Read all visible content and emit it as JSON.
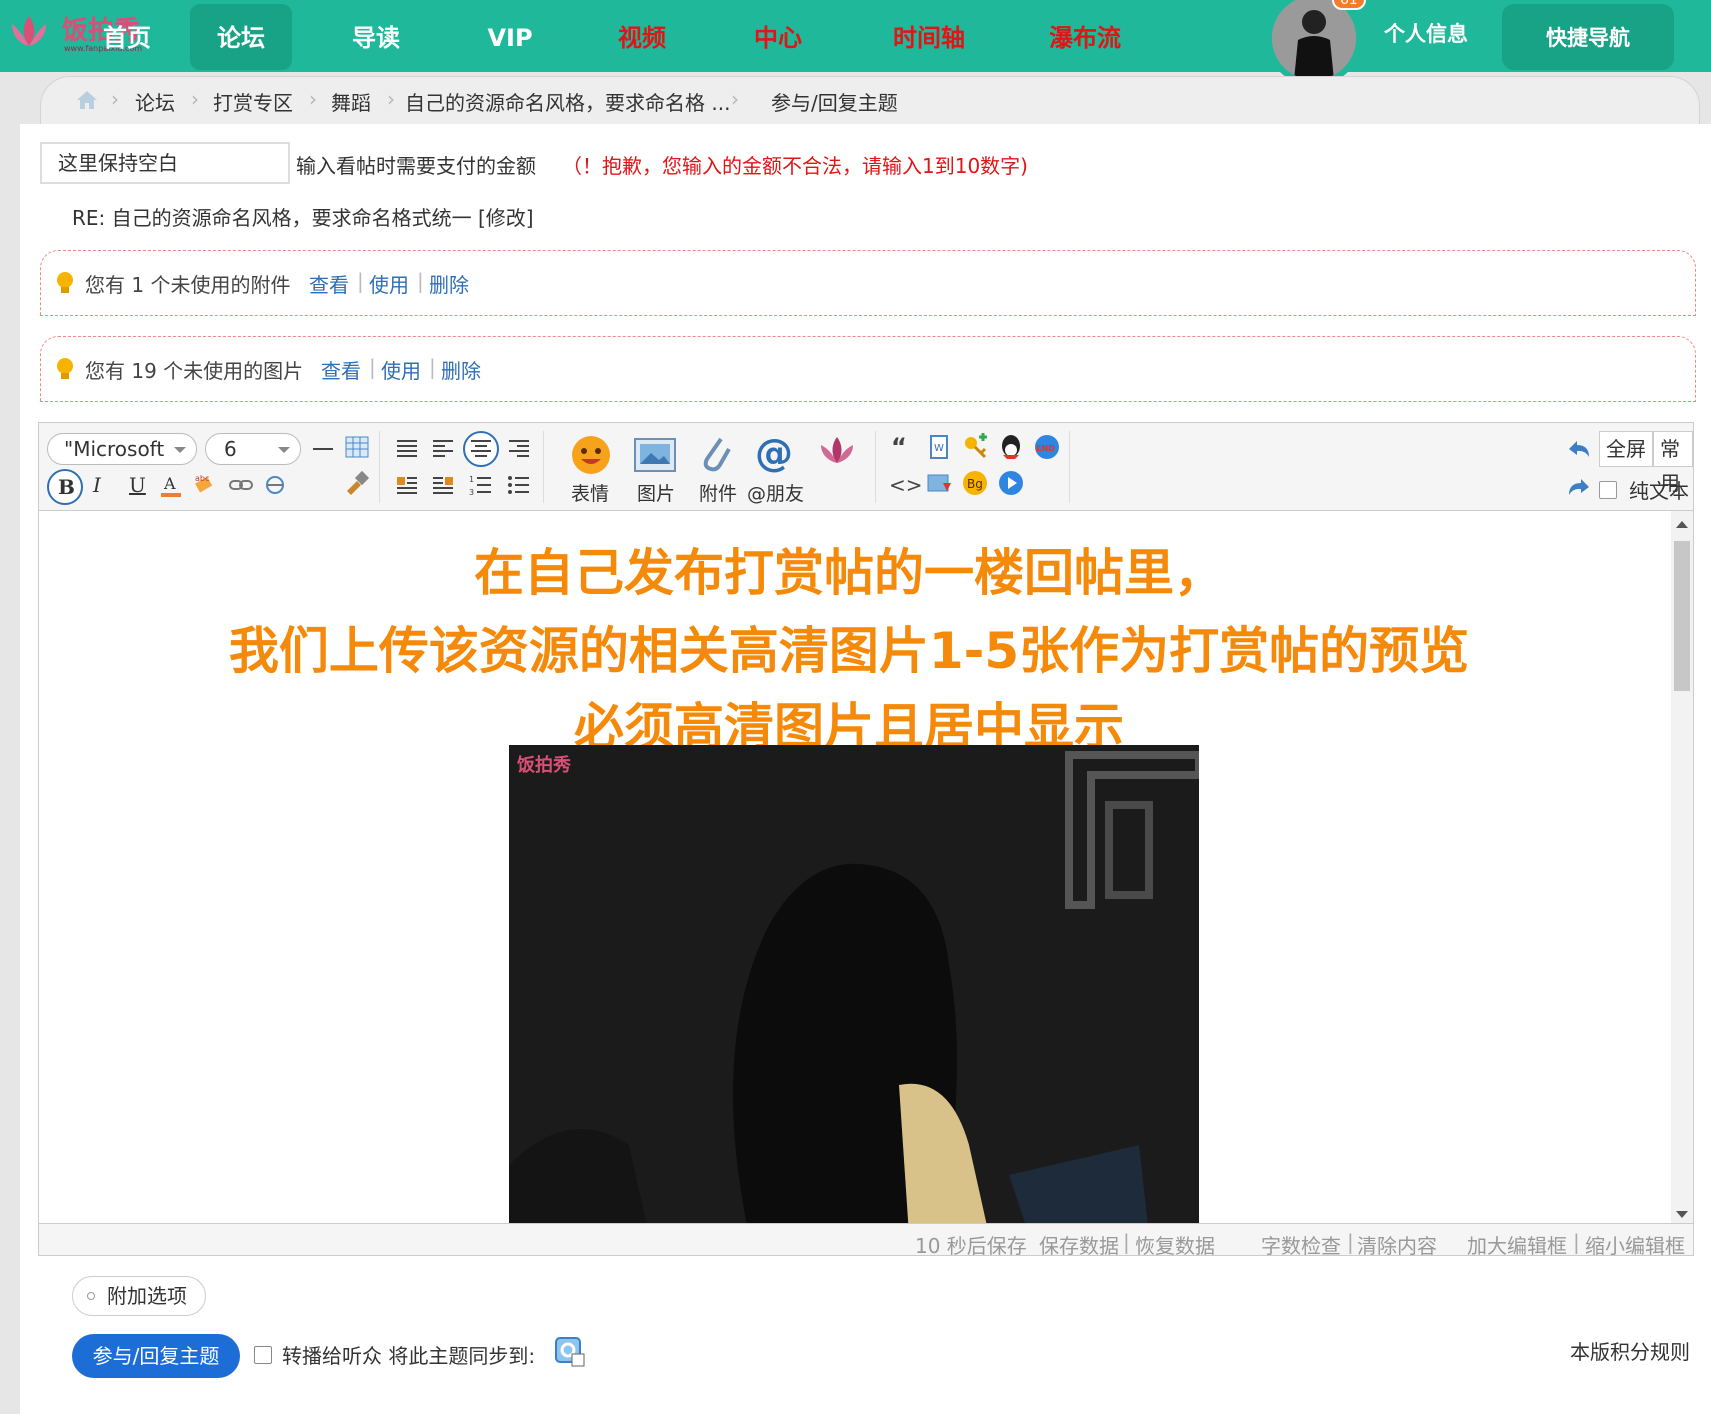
{
  "colors": {
    "brand_green": "#1fb89a",
    "nav_active": "#18a286",
    "nav_red": "#e01515",
    "headline_orange": "#f5890a",
    "link_blue": "#2f6fb5",
    "submit_blue": "#1c6ed6"
  },
  "logo": {
    "text": "饭拍秀",
    "sub": "www.fanpaixiu.com"
  },
  "nav": {
    "items": [
      {
        "label": "首页",
        "style": "normal"
      },
      {
        "label": "论坛",
        "style": "active"
      },
      {
        "label": "导读",
        "style": "normal"
      },
      {
        "label": "VIP",
        "style": "normal"
      },
      {
        "label": "视频",
        "style": "red"
      },
      {
        "label": "中心",
        "style": "red"
      },
      {
        "label": "时间轴",
        "style": "red"
      },
      {
        "label": "瀑布流",
        "style": "red"
      }
    ],
    "badge": "61",
    "profile": "个人信息",
    "quick_nav": "快捷导航"
  },
  "breadcrumb": [
    "论坛",
    "打赏专区",
    "舞蹈",
    "自己的资源命名风格，要求命名格 ...",
    "参与/回复主题"
  ],
  "form": {
    "amount_value": "这里保持空白",
    "amount_label": "输入看帖时需要支付的金额",
    "amount_error": "（！抱歉，您输入的金额不合法，请输入1到10数字)",
    "re_title": "RE: 自己的资源命名风格，要求命名格式统一 [修改]"
  },
  "notices": [
    {
      "text": "您有 1 个未使用的附件",
      "view": "查看",
      "use": "使用",
      "delete": "删除"
    },
    {
      "text": "您有 19 个未使用的图片",
      "view": "查看",
      "use": "使用",
      "delete": "删除"
    }
  ],
  "editor": {
    "font": "\"Microsoft",
    "size": "6",
    "big_buttons": [
      "表情",
      "图片",
      "附件",
      "@朋友"
    ],
    "fullscreen": "全屏",
    "common": "常用",
    "plain_text": "纯文本",
    "headline": [
      "在自己发布打赏帖的一楼回帖里，",
      "我们上传该资源的相关高清图片1-5张作为打赏帖的预览",
      "必须高清图片且居中显示"
    ],
    "photo_logo": "饭拍秀",
    "status": {
      "autosave": "10 秒后保存",
      "save": "保存数据",
      "restore": "恢复数据",
      "count": "字数检查",
      "clear": "清除内容",
      "enlarge": "加大编辑框",
      "shrink": "缩小编辑框"
    }
  },
  "bottom": {
    "extra_options": "附加选项",
    "submit": "参与/回复主题",
    "forward": "转播给听众 将此主题同步到:",
    "rules": "本版积分规则"
  }
}
